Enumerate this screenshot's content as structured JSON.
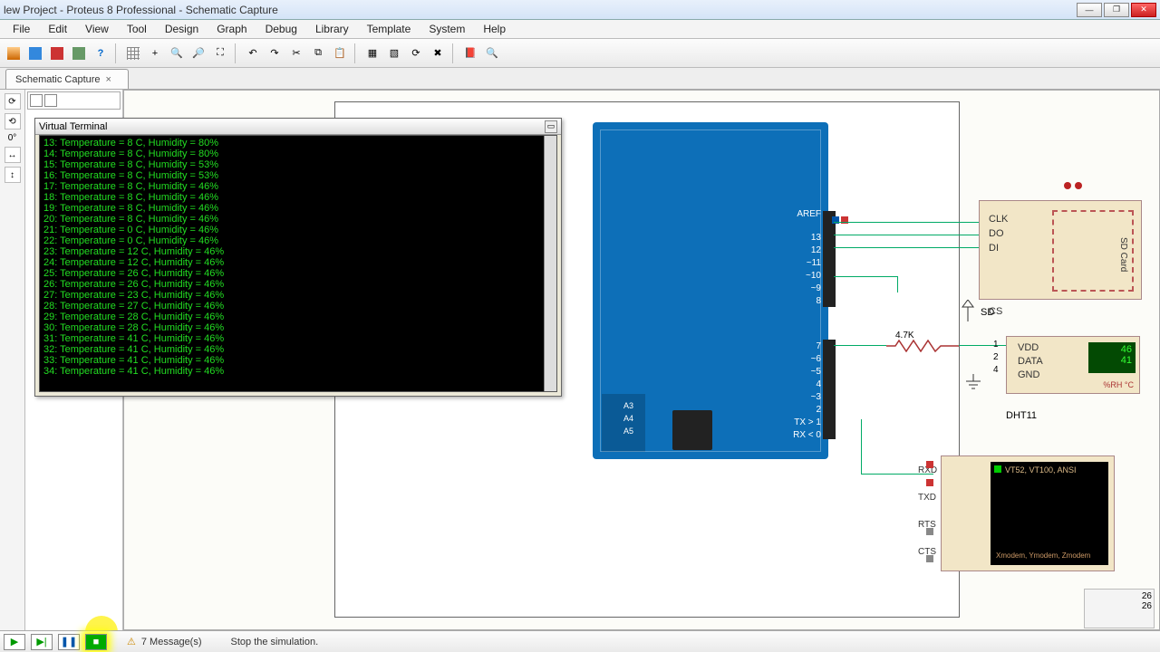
{
  "title": "lew Project - Proteus 8 Professional - Schematic Capture",
  "menu": [
    "File",
    "Edit",
    "View",
    "Tool",
    "Design",
    "Graph",
    "Debug",
    "Library",
    "Template",
    "System",
    "Help"
  ],
  "tab": {
    "label": "Schematic Capture"
  },
  "vt_window": {
    "title": "Virtual Terminal"
  },
  "terminal_lines": [
    {
      "n": "13",
      "t": "8",
      "h": "80"
    },
    {
      "n": "14",
      "t": "8",
      "h": "80"
    },
    {
      "n": "15",
      "t": "8",
      "h": "53"
    },
    {
      "n": "16",
      "t": "8",
      "h": "53"
    },
    {
      "n": "17",
      "t": "8",
      "h": "46"
    },
    {
      "n": "18",
      "t": "8",
      "h": "46"
    },
    {
      "n": "19",
      "t": "8",
      "h": "46"
    },
    {
      "n": "20",
      "t": "8",
      "h": "46"
    },
    {
      "n": "21",
      "t": "0",
      "h": "46"
    },
    {
      "n": "22",
      "t": "0",
      "h": "46"
    },
    {
      "n": "23",
      "t": "12",
      "h": "46"
    },
    {
      "n": "24",
      "t": "12",
      "h": "46"
    },
    {
      "n": "25",
      "t": "26",
      "h": "46"
    },
    {
      "n": "26",
      "t": "26",
      "h": "46"
    },
    {
      "n": "27",
      "t": "23",
      "h": "46"
    },
    {
      "n": "28",
      "t": "27",
      "h": "46"
    },
    {
      "n": "29",
      "t": "28",
      "h": "46"
    },
    {
      "n": "30",
      "t": "28",
      "h": "46"
    },
    {
      "n": "31",
      "t": "41",
      "h": "46"
    },
    {
      "n": "32",
      "t": "41",
      "h": "46"
    },
    {
      "n": "33",
      "t": "41",
      "h": "46"
    },
    {
      "n": "34",
      "t": "41",
      "h": "46"
    }
  ],
  "arduino": {
    "aref": "AREF",
    "pins_r1": [
      "13",
      "12",
      "~11",
      "~10",
      "~9",
      "8"
    ],
    "pins_r2": [
      "7",
      "~6",
      "~5",
      "4",
      "~3",
      "2",
      "TX > 1",
      "RX < 0"
    ],
    "analog": [
      "A3",
      "A4",
      "A5"
    ]
  },
  "sd": {
    "pins": [
      "CLK",
      "DO",
      "DI",
      "CS"
    ],
    "label": "SD",
    "chip": "SD Card"
  },
  "resistor": "4.7K",
  "dht": {
    "pins": [
      "VDD",
      "DATA",
      "GND"
    ],
    "idx": [
      "1",
      "2",
      "4"
    ],
    "display": [
      "46",
      "41"
    ],
    "units": "%RH   °C",
    "label": "DHT11"
  },
  "vterm": {
    "pins": [
      "RXD",
      "TXD",
      "RTS",
      "CTS"
    ],
    "line1": "VT52, VT100, ANSI",
    "line2": "Xmodem, Ymodem, Zmodem"
  },
  "status": {
    "messages": "7 Message(s)",
    "hint": "Stop the simulation.",
    "right": [
      "26",
      "26"
    ]
  }
}
